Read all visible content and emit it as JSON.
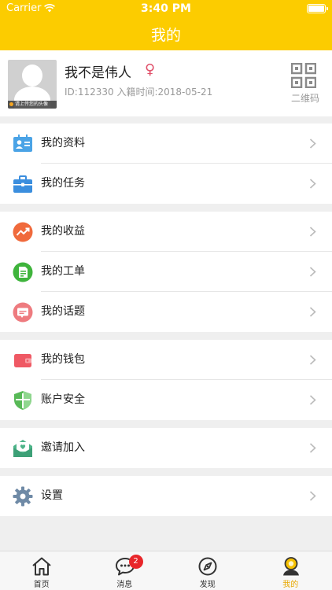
{
  "status_bar": {
    "carrier": "Carrier",
    "time": "3:40 PM"
  },
  "header": {
    "title": "我的"
  },
  "profile": {
    "avatar_caption": "请上传您的头像",
    "name": "我不是伟人",
    "gender_symbol": "♀",
    "meta": "ID:112330 入籍时间:2018-05-21",
    "qr_label": "二维码"
  },
  "menu": {
    "group1": [
      {
        "label": "我的资料",
        "icon": "profile-card-icon"
      },
      {
        "label": "我的任务",
        "icon": "briefcase-icon"
      }
    ],
    "group2": [
      {
        "label": "我的收益",
        "icon": "earnings-trend-icon"
      },
      {
        "label": "我的工单",
        "icon": "work-order-icon"
      },
      {
        "label": "我的话题",
        "icon": "topic-chat-icon"
      }
    ],
    "group3": [
      {
        "label": "我的钱包",
        "icon": "wallet-icon"
      },
      {
        "label": "账户安全",
        "icon": "shield-icon"
      }
    ],
    "group4": [
      {
        "label": "邀请加入",
        "icon": "invite-envelope-icon"
      }
    ],
    "group5": [
      {
        "label": "设置",
        "icon": "gear-icon"
      }
    ]
  },
  "tabbar": {
    "tabs": [
      {
        "label": "首页",
        "icon": "home-icon"
      },
      {
        "label": "消息",
        "icon": "message-icon",
        "badge": "2"
      },
      {
        "label": "发现",
        "icon": "compass-icon"
      },
      {
        "label": "我的",
        "icon": "user-icon",
        "active": true
      }
    ]
  },
  "colors": {
    "accent": "#fccc00",
    "active_tab": "#e8a800",
    "badge": "#e8262a"
  }
}
